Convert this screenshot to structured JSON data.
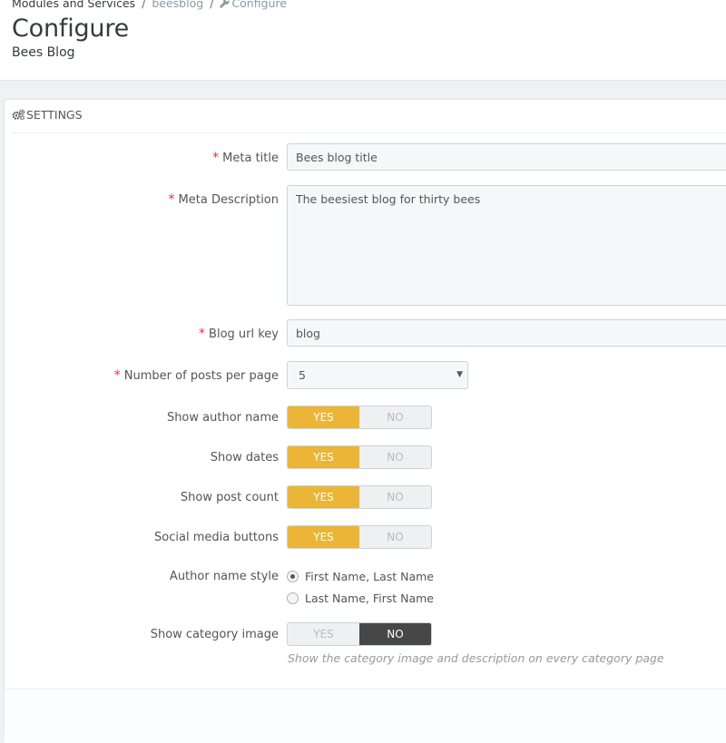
{
  "breadcrumb": {
    "item1": "Modules and Services",
    "sep1": "/",
    "item2": "beesblog",
    "sep2": "/",
    "item3": "Configure"
  },
  "header": {
    "title": "Configure",
    "subtitle": "Bees Blog"
  },
  "panel": {
    "heading": "SETTINGS"
  },
  "form": {
    "required_mark": "*",
    "meta_title": {
      "label": "Meta title",
      "value": "Bees blog title"
    },
    "meta_description": {
      "label": "Meta Description",
      "value": "The beesiest blog for thirty bees"
    },
    "blog_url_key": {
      "label": "Blog url key",
      "value": "blog"
    },
    "posts_per_page": {
      "label": "Number of posts per page",
      "value": "5",
      "caret": "▼"
    },
    "show_author_name": {
      "label": "Show author name",
      "yes": "YES",
      "no": "NO",
      "selected": "YES"
    },
    "show_dates": {
      "label": "Show dates",
      "yes": "YES",
      "no": "NO",
      "selected": "YES"
    },
    "show_post_count": {
      "label": "Show post count",
      "yes": "YES",
      "no": "NO",
      "selected": "YES"
    },
    "social_media_buttons": {
      "label": "Social media buttons",
      "yes": "YES",
      "no": "NO",
      "selected": "YES"
    },
    "author_name_style": {
      "label": "Author name style",
      "options": [
        "First Name, Last Name",
        "Last Name, First Name"
      ],
      "selected": "First Name, Last Name"
    },
    "show_category_image": {
      "label": "Show category image",
      "yes": "YES",
      "no": "NO",
      "selected": "NO",
      "help": "Show the category image and description on every category page"
    }
  },
  "colors": {
    "accent_yes": "#ebb537",
    "accent_no_active": "#474747",
    "required": "#e0343c"
  }
}
